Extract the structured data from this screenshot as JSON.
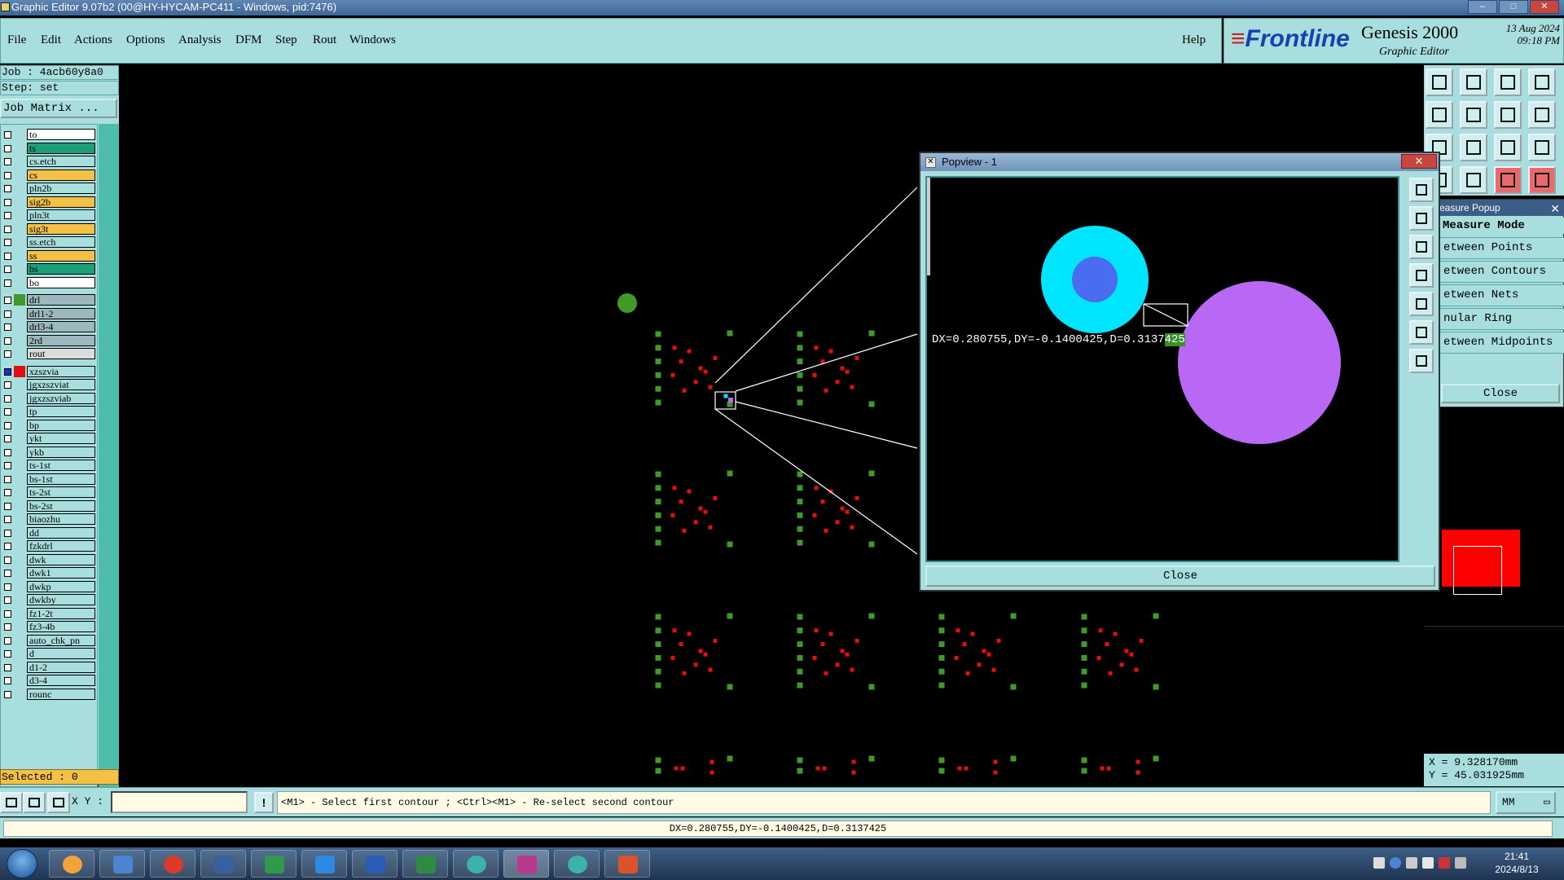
{
  "window": {
    "title": "Graphic Editor 9.07b2 (00@HY-HYCAM-PC411 - Windows, pid:7476)",
    "buttons": [
      "–",
      "□",
      "✕"
    ]
  },
  "menu": {
    "items": [
      "File",
      "Edit",
      "Actions",
      "Options",
      "Analysis",
      "DFM",
      "Step",
      "Rout",
      "Windows"
    ],
    "help": "Help"
  },
  "brand": {
    "logo": "Frontline",
    "product": "Genesis 2000",
    "subtitle": "Graphic Editor",
    "date": "13 Aug 2024",
    "time": "09:18 PM"
  },
  "job": {
    "job_line": "Job : 4acb60y8a0",
    "step_line": "Step: set",
    "matrix_button": "Job Matrix ..."
  },
  "layers": [
    {
      "name": "to",
      "color": "#ffffff"
    },
    {
      "name": "ts",
      "color": "#1f9e7a"
    },
    {
      "name": "cs.etch",
      "color": "#a8dede"
    },
    {
      "name": "cs",
      "color": "#f4c045"
    },
    {
      "name": "pln2b",
      "color": "#a8dede"
    },
    {
      "name": "sig2b",
      "color": "#f4c045"
    },
    {
      "name": "pln3t",
      "color": "#a8dede"
    },
    {
      "name": "sig3t",
      "color": "#f4c045"
    },
    {
      "name": "ss.etch",
      "color": "#a8dede"
    },
    {
      "name": "ss",
      "color": "#f4c045"
    },
    {
      "name": "bs",
      "color": "#1f9e7a"
    },
    {
      "name": "bo",
      "color": "#ffffff"
    },
    {
      "name": "drl",
      "color": "#9db7bf",
      "swatch": "#3f9a2a"
    },
    {
      "name": "drl1-2",
      "color": "#9db7bf"
    },
    {
      "name": "drl3-4",
      "color": "#9db7bf"
    },
    {
      "name": "2rd",
      "color": "#9db7bf"
    },
    {
      "name": "rout",
      "color": "#dcdcdc"
    },
    {
      "name": "xzszvia",
      "color": "#a8dede",
      "swatch": "#e01010",
      "active": true
    },
    {
      "name": "jgxzszviat",
      "color": "#a8dede"
    },
    {
      "name": "jgxzszviab",
      "color": "#a8dede"
    },
    {
      "name": "tp",
      "color": "#a8dede"
    },
    {
      "name": "bp",
      "color": "#a8dede"
    },
    {
      "name": "ykt",
      "color": "#a8dede"
    },
    {
      "name": "ykb",
      "color": "#a8dede"
    },
    {
      "name": "ts-1st",
      "color": "#a8dede"
    },
    {
      "name": "bs-1st",
      "color": "#a8dede"
    },
    {
      "name": "ts-2st",
      "color": "#a8dede"
    },
    {
      "name": "bs-2st",
      "color": "#a8dede"
    },
    {
      "name": "biaozhu",
      "color": "#a8dede"
    },
    {
      "name": "dd",
      "color": "#a8dede"
    },
    {
      "name": "fzkdrl",
      "color": "#a8dede"
    },
    {
      "name": "dwk",
      "color": "#a8dede"
    },
    {
      "name": "dwk1",
      "color": "#a8dede"
    },
    {
      "name": "dwkp",
      "color": "#a8dede"
    },
    {
      "name": "dwkby",
      "color": "#a8dede"
    },
    {
      "name": "fz1-2t",
      "color": "#a8dede"
    },
    {
      "name": "fz3-4b",
      "color": "#a8dede"
    },
    {
      "name": "auto_chk_pn",
      "color": "#a8dede"
    },
    {
      "name": "d",
      "color": "#a8dede"
    },
    {
      "name": "d1-2",
      "color": "#a8dede"
    },
    {
      "name": "d3-4",
      "color": "#a8dede"
    },
    {
      "name": "rounc",
      "color": "#a8dede"
    }
  ],
  "selected": "Selected : 0",
  "popview": {
    "title": "Popview - 1",
    "close_x": "✕",
    "measurement_main": "DX=0.280755,DY=-0.1400425,D=0.3137",
    "measurement_highlight": "425",
    "close_label": "Close"
  },
  "measure_popup": {
    "title": "easure Popup",
    "close_x": "✕",
    "header": "Measure Mode",
    "modes": [
      "etween Points",
      "etween Contours",
      "etween Nets",
      "nular Ring",
      "etween Midpoints"
    ],
    "close_label": "Close"
  },
  "coords": {
    "x": "X = 9.328170mm",
    "y": "Y = 45.031925mm"
  },
  "bottom": {
    "xy_label": "X Y :",
    "xy_value": "",
    "warn": "!",
    "prompt": "<M1> - Select first contour ; <Ctrl><M1> - Re-select second contour",
    "unit": "MM"
  },
  "status": "DX=0.280755,DY=-0.1400425,D=0.3137425",
  "taskbar": {
    "time": "21:41",
    "date": "2024/8/13"
  },
  "colors": {
    "panel": "#a8dede",
    "pad_green": "#3f9a2a",
    "pad_red": "#e01010",
    "cyan": "#00e5ff",
    "blue": "#4a6cf0",
    "violet": "#b968f5"
  }
}
